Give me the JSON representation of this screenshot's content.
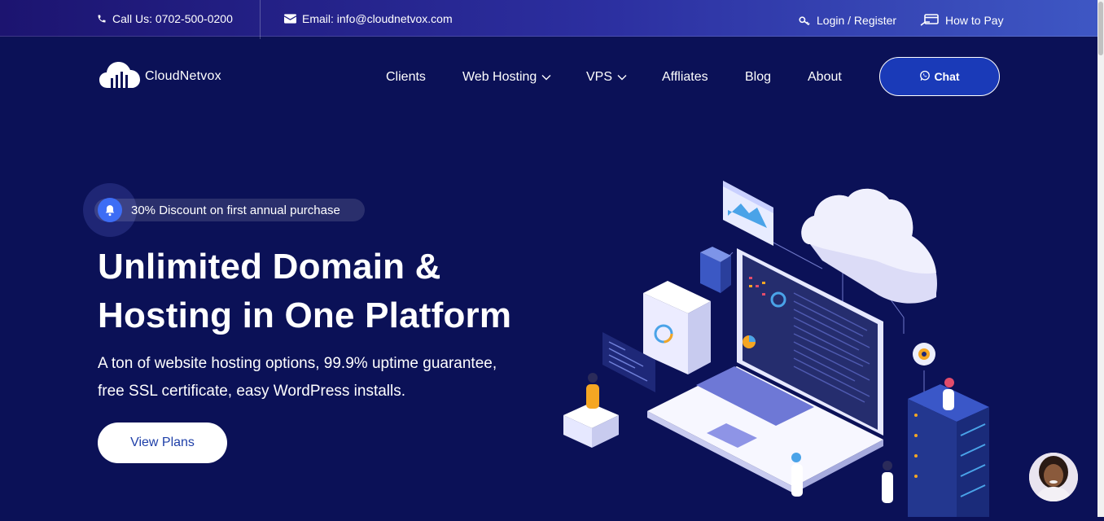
{
  "topbar": {
    "phone_text": "Call Us: 0702-500-0200",
    "email_text": "Email: info@cloudnetvox.com",
    "login_text": "Login / Register",
    "howtopay_text": "How to Pay"
  },
  "brand": {
    "name": "CloudNetvox"
  },
  "nav": {
    "items": [
      {
        "label": "Clients"
      },
      {
        "label": "Web Hosting"
      },
      {
        "label": "VPS"
      },
      {
        "label": "Affliates"
      },
      {
        "label": "Blog"
      },
      {
        "label": "About"
      }
    ],
    "chat_label": "Chat"
  },
  "hero": {
    "badge_text": "30% Discount on first annual purchase",
    "title_line1": "Unlimited Domain &",
    "title_line2": "Hosting in One Platform",
    "subtitle_line1": "A ton of website hosting options, 99.9% uptime guarantee,",
    "subtitle_line2": "free SSL certificate, easy WordPress installs.",
    "cta_label": "View Plans"
  },
  "colors": {
    "background": "#0b1157",
    "accent": "#1a3ab8",
    "bell": "#3d6df5",
    "cta_text": "#1e3fa8"
  }
}
